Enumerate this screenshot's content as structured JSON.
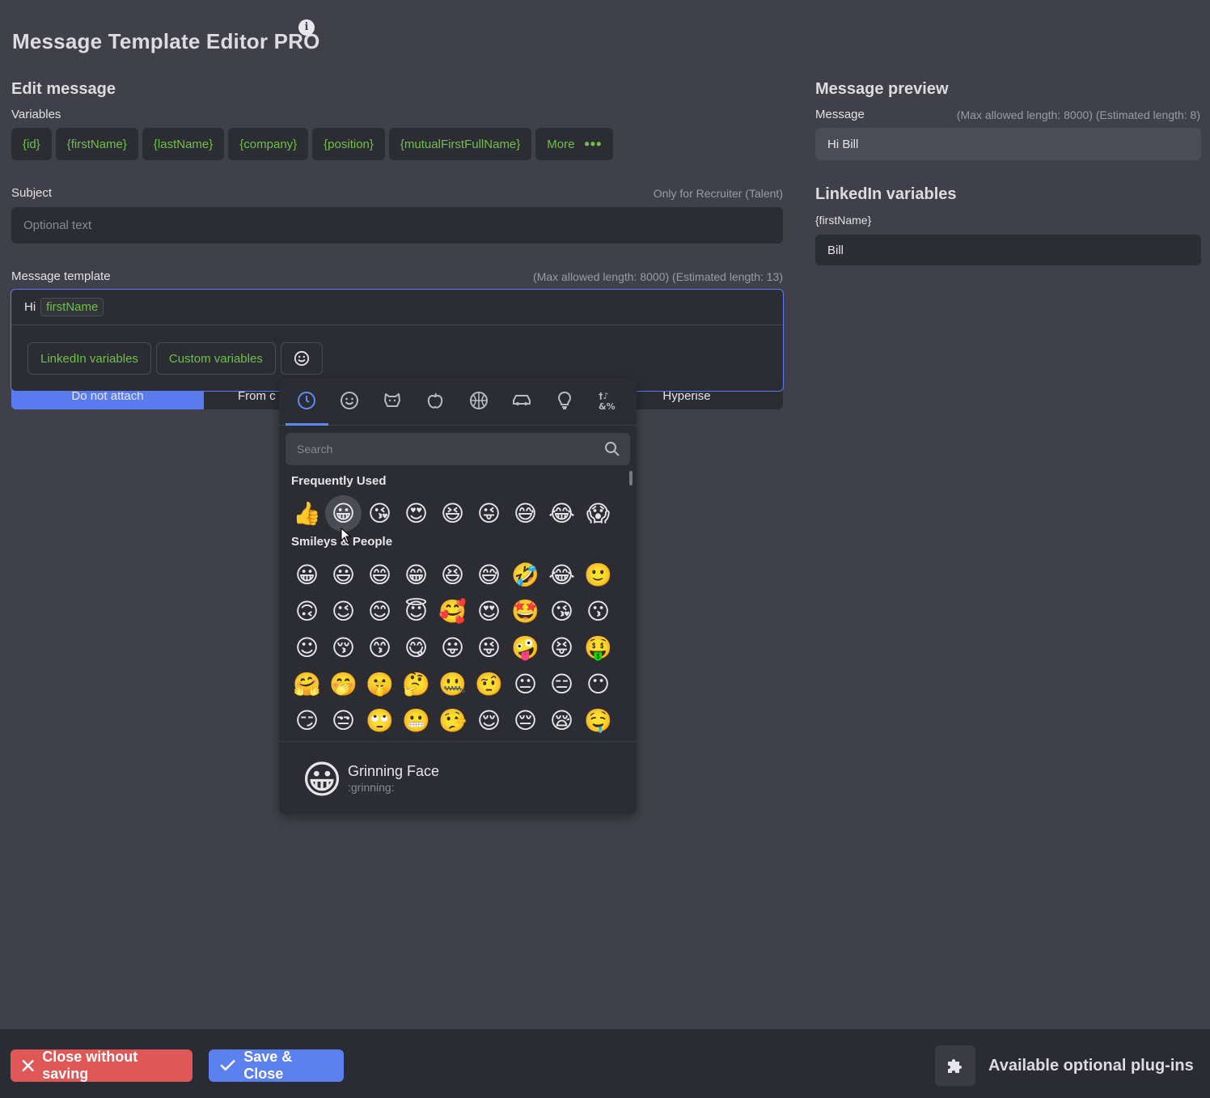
{
  "app": {
    "title": "Message Template Editor PRO",
    "info": "i"
  },
  "edit": {
    "title": "Edit message",
    "variables_label": "Variables",
    "chips": [
      "{id}",
      "{firstName}",
      "{lastName}",
      "{company}",
      "{position}",
      "{mutualFirstFullName}"
    ],
    "more_label": "More",
    "more_dots": "•••",
    "subject_label": "Subject",
    "subject_hint": "Only for Recruiter (Talent)",
    "subject_placeholder": "Optional text",
    "template_label": "Message template",
    "template_hint": "(Max allowed length: 8000) (Estimated length: 13)",
    "template_text": "Hi",
    "template_var": "firstName",
    "linkedin_vars_btn": "LinkedIn variables",
    "custom_vars_btn": "Custom variables",
    "emoji_btn": "☺",
    "attach_options": [
      "Do not attach",
      "From c",
      "Hyperise"
    ]
  },
  "preview": {
    "title": "Message preview",
    "message_label": "Message",
    "message_hint": "(Max allowed length: 8000) (Estimated length: 8)",
    "message_value": "Hi Bill",
    "linkedin_title": "LinkedIn variables",
    "var_label": "{firstName}",
    "var_value": "Bill"
  },
  "emoji_picker": {
    "categories": [
      "clock-icon",
      "smiley-icon",
      "animal-icon",
      "food-icon",
      "activity-icon",
      "travel-icon",
      "objects-icon",
      "symbols-icon"
    ],
    "category_glyphs": [
      "◷",
      "☺",
      "🐶",
      "🍎",
      "⚽",
      "🚗",
      "💡",
      "&%"
    ],
    "search_placeholder": "Search",
    "frequent_title": "Frequently Used",
    "frequent": [
      "👍",
      "😀",
      "😘",
      "😍",
      "😆",
      "😜",
      "😅",
      "😂",
      "😱"
    ],
    "smileys_title": "Smileys & People",
    "smileys": [
      "😀",
      "😃",
      "😄",
      "😁",
      "😆",
      "😅",
      "🤣",
      "😂",
      "🙂",
      "🙃",
      "😉",
      "😊",
      "😇",
      "🥰",
      "😍",
      "🤩",
      "😘",
      "😗",
      "☺",
      "😚",
      "😙",
      "😋",
      "😛",
      "😜",
      "🤪",
      "😝",
      "🤑",
      "🤗",
      "🤭",
      "🤫",
      "🤔",
      "🤐",
      "🤨",
      "😐",
      "😑",
      "😶",
      "😏",
      "😒",
      "🙄",
      "😬",
      "🤥",
      "😌",
      "😔",
      "😪",
      "🤤"
    ],
    "preview_emoji": "😀",
    "preview_name": "Grinning Face",
    "preview_code": ":grinning:"
  },
  "footer": {
    "close_label": "Close without saving",
    "save_label": "Save & Close",
    "plugins_label": "Available optional plug-ins"
  },
  "colors": {
    "accent": "#5b80f0",
    "danger": "#e05757",
    "variable": "#6fbf4a",
    "background": "#3f4049"
  }
}
